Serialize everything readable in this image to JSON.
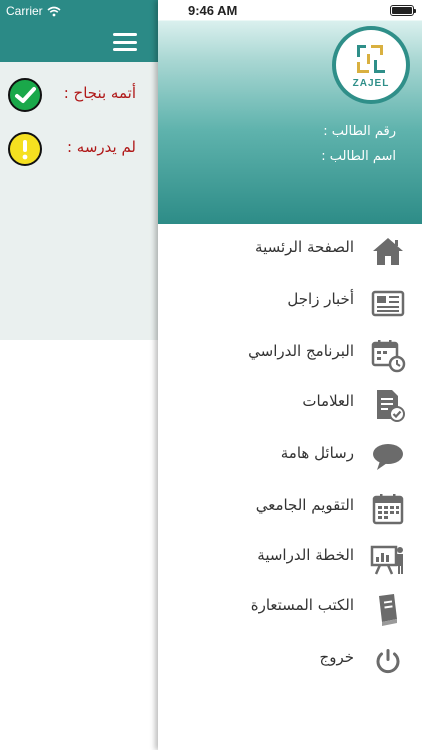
{
  "status_bar": {
    "carrier": "Carrier",
    "time": "9:46 AM"
  },
  "background_page": {
    "rows": [
      {
        "label": "أتمه بنجاح :",
        "state": "done",
        "color": "#1aa84a"
      },
      {
        "label": "لم يدرسه :",
        "state": "pending",
        "color": "#f5e020"
      }
    ]
  },
  "drawer": {
    "logo_text": "ZAJEL",
    "student_number_label": "رقم الطالب :",
    "student_name_label": "اسم الطالب :",
    "items": [
      {
        "label": "الصفحة الرئسية",
        "icon": "home-icon"
      },
      {
        "label": "أخبار زاجل",
        "icon": "newspaper-icon"
      },
      {
        "label": "البرنامج الدراسي",
        "icon": "calendar-clock-icon"
      },
      {
        "label": "العلامات",
        "icon": "grades-document-icon"
      },
      {
        "label": "رسائل هامة",
        "icon": "chat-bubble-icon"
      },
      {
        "label": "التقويم الجامعي",
        "icon": "calendar-icon"
      },
      {
        "label": "الخطة الدراسية",
        "icon": "presentation-icon"
      },
      {
        "label": "الكتب المستعارة",
        "icon": "book-icon"
      },
      {
        "label": "خروج",
        "icon": "power-icon"
      }
    ]
  },
  "colors": {
    "teal": "#2b8a86",
    "panel_bg": "#eaf0ef",
    "label_red": "#b01818",
    "icon_gray": "#6b6b6b"
  }
}
